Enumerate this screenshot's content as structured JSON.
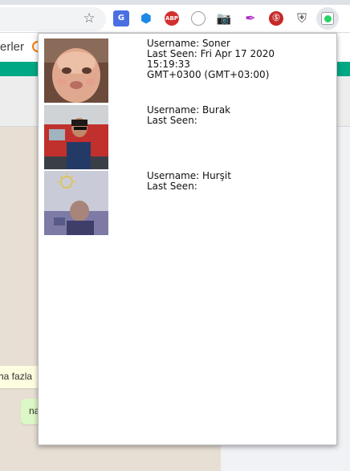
{
  "browser": {
    "extensions": [
      {
        "name": "bookmark-star-icon"
      },
      {
        "name": "google-translate-icon",
        "glyph": "G"
      },
      {
        "name": "blue-hex-extension-icon",
        "glyph": "⬢"
      },
      {
        "name": "adblock-plus-icon",
        "glyph": "ABP"
      },
      {
        "name": "ring-extension-icon"
      },
      {
        "name": "camera-icon",
        "glyph": "📷"
      },
      {
        "name": "feather-icon",
        "glyph": "✒"
      },
      {
        "name": "red-extension-icon",
        "glyph": "Ⓢ"
      },
      {
        "name": "shield-icon",
        "glyph": "⛨"
      },
      {
        "name": "whatsapp-extension-icon"
      }
    ]
  },
  "background_page": {
    "bookmark_fragment": "erler",
    "incoming_message_fragment": "ha fazla",
    "outgoing_message_fragment": "na"
  },
  "popup": {
    "username_label": "Username:",
    "last_seen_label": "Last Seen:",
    "users": [
      {
        "username": "Soner",
        "last_seen_line1": "Fri Apr 17 2020 15:19:33",
        "last_seen_line2": "GMT+0300 (GMT+03:00)"
      },
      {
        "username": "Burak",
        "last_seen_line1": "",
        "last_seen_line2": ""
      },
      {
        "username": "Hurşit",
        "last_seen_line1": "",
        "last_seen_line2": ""
      }
    ]
  },
  "colors": {
    "whatsapp_teal": "#00a884",
    "chat_background": "#e8dfd4",
    "incoming_bubble": "#fffde0",
    "outgoing_bubble": "#dcf8c6",
    "abp_red": "#d32f2f"
  }
}
